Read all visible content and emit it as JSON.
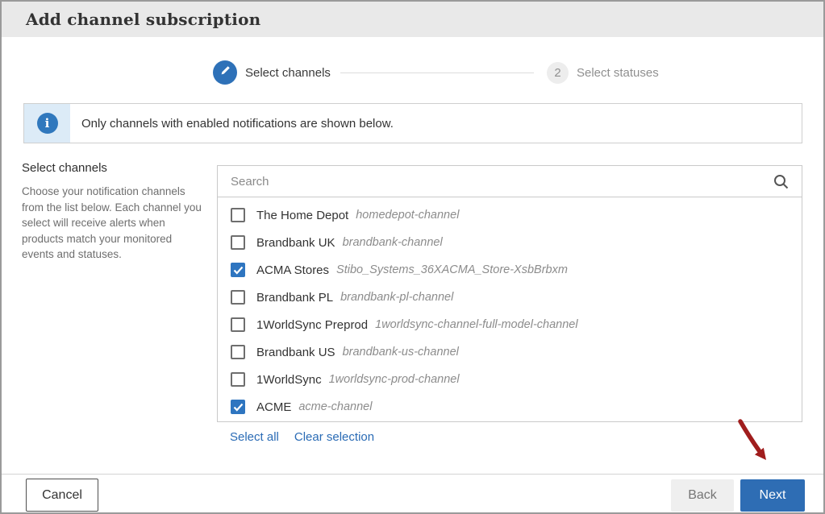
{
  "dialog": {
    "title": "Add channel subscription"
  },
  "stepper": {
    "steps": [
      {
        "label": "Select channels",
        "state": "active",
        "icon": "pencil-icon"
      },
      {
        "number": "2",
        "label": "Select statuses",
        "state": "upcoming"
      }
    ]
  },
  "info_banner": {
    "icon": "info-icon",
    "icon_glyph": "i",
    "text": "Only channels with enabled notifications are shown below."
  },
  "left_panel": {
    "heading": "Select channels",
    "description": "Choose your notification channels from the list below. Each channel you select will receive alerts when products match your monitored events and statuses."
  },
  "channel_list": {
    "search_placeholder": "Search",
    "items": [
      {
        "name": "The Home Depot",
        "code": "homedepot-channel",
        "checked": false
      },
      {
        "name": "Brandbank UK",
        "code": "brandbank-channel",
        "checked": false
      },
      {
        "name": "ACMA Stores",
        "code": "Stibo_Systems_36XACMA_Store-XsbBrbxm",
        "checked": true
      },
      {
        "name": "Brandbank PL",
        "code": "brandbank-pl-channel",
        "checked": false
      },
      {
        "name": "1WorldSync Preprod",
        "code": "1worldsync-channel-full-model-channel",
        "checked": false
      },
      {
        "name": "Brandbank US",
        "code": "brandbank-us-channel",
        "checked": false
      },
      {
        "name": "1WorldSync",
        "code": "1worldsync-prod-channel",
        "checked": false
      },
      {
        "name": "ACME",
        "code": "acme-channel",
        "checked": true
      }
    ],
    "select_all_label": "Select all",
    "clear_selection_label": "Clear selection"
  },
  "footer": {
    "cancel_label": "Cancel",
    "back_label": "Back",
    "next_label": "Next"
  },
  "colors": {
    "accent_blue": "#2e71b8",
    "checkbox_blue": "#2e75c0",
    "link_blue": "#2a6bb5",
    "banner_strip_blue": "#dcebf7",
    "titlebar_gray": "#e9e9e9",
    "annotation_red": "#a01d1d"
  }
}
